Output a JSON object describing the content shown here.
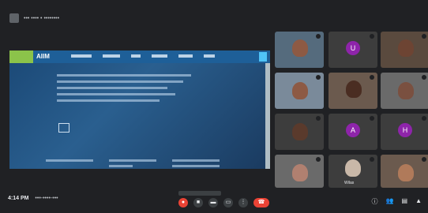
{
  "top": {
    "presenter_label": "••• •••• • ••••••••"
  },
  "shared_screen": {
    "brand": "AIIM",
    "icons": {
      "hdr_button": "square-icon",
      "link_icon": "square-icon"
    }
  },
  "participants": [
    {
      "name": "",
      "kind": "video"
    },
    {
      "name": "",
      "kind": "avatar",
      "initial": "U"
    },
    {
      "name": "",
      "kind": "video"
    },
    {
      "name": "",
      "kind": "video"
    },
    {
      "name": "",
      "kind": "video"
    },
    {
      "name": "",
      "kind": "video"
    },
    {
      "name": "",
      "kind": "video"
    },
    {
      "name": "",
      "kind": "avatar",
      "initial": "A"
    },
    {
      "name": "",
      "kind": "avatar",
      "initial": "H"
    },
    {
      "name": "",
      "kind": "video"
    },
    {
      "name": "Wilas",
      "kind": "video"
    },
    {
      "name": "",
      "kind": "video"
    }
  ],
  "bottom": {
    "time": "4:14 PM",
    "meeting_code": "•••-••••-•••"
  }
}
